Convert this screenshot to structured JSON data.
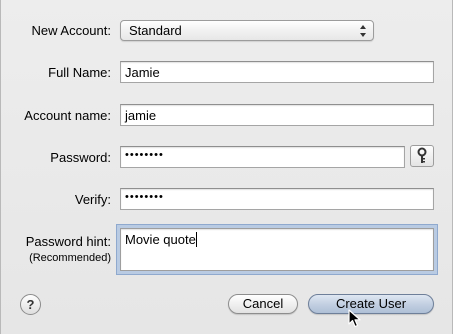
{
  "form": {
    "new_account_label": "New Account:",
    "account_type": "Standard",
    "full_name_label": "Full Name:",
    "full_name_value": "Jamie",
    "account_name_label": "Account name:",
    "account_name_value": "jamie",
    "password_label": "Password:",
    "password_value": "••••••••",
    "verify_label": "Verify:",
    "verify_value": "••••••••",
    "hint_label": "Password hint:",
    "hint_sublabel": "(Recommended)",
    "hint_value": "Movie quote"
  },
  "buttons": {
    "help": "?",
    "cancel": "Cancel",
    "create": "Create User"
  },
  "icons": {
    "popup_arrows": "up-down-arrows-icon",
    "key": "key-icon",
    "pointer": "mouse-pointer-icon"
  },
  "colors": {
    "focus_ring": "#8fa9ce",
    "default_button": "#c3d0e2",
    "background": "#ececec"
  }
}
